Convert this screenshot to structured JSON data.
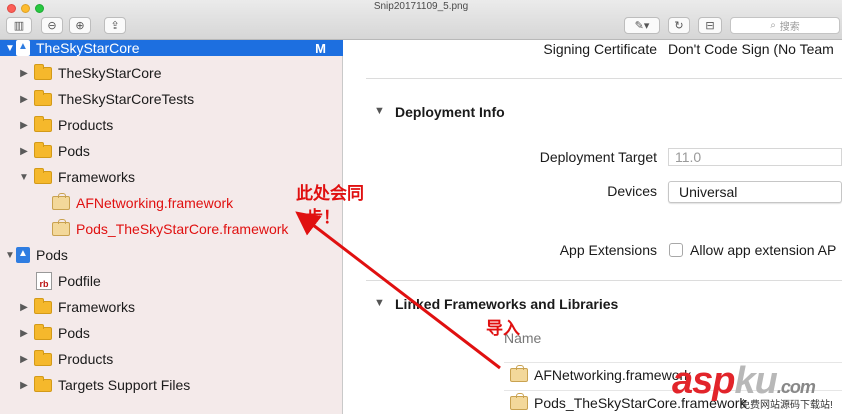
{
  "window": {
    "title": "Snip20171109_5.png",
    "search_placeholder": "搜索"
  },
  "sidebar": {
    "items": [
      {
        "label": "TheSkyStarCore",
        "badge": "M"
      },
      {
        "label": "TheSkyStarCore"
      },
      {
        "label": "TheSkyStarCoreTests"
      },
      {
        "label": "Products"
      },
      {
        "label": "Pods"
      },
      {
        "label": "Frameworks"
      },
      {
        "label": "AFNetworking.framework"
      },
      {
        "label": "Pods_TheSkyStarCore.framework"
      },
      {
        "label": "Pods"
      },
      {
        "label": "Podfile"
      },
      {
        "label": "Frameworks"
      },
      {
        "label": "Pods"
      },
      {
        "label": "Products"
      },
      {
        "label": "Targets Support Files"
      }
    ]
  },
  "main": {
    "signing_label": "Signing Certificate",
    "signing_value": "Don't Code Sign (No Team",
    "deployment_title": "Deployment Info",
    "deployment_target_label": "Deployment Target",
    "deployment_target_value": "11.0",
    "devices_label": "Devices",
    "devices_value": "Universal",
    "app_ext_label": "App Extensions",
    "app_ext_value": "Allow app extension AP",
    "linked_title": "Linked Frameworks and Libraries",
    "list_header": "Name",
    "linked_items": [
      "AFNetworking.framework",
      "Pods_TheSkyStarCore.framework"
    ]
  },
  "annotations": {
    "sync_line1": "此处会同",
    "sync_line2": "步！",
    "import": "导入"
  },
  "watermark": {
    "text_asp": "asp",
    "text_ku": "ku",
    "text_com": ".com",
    "subtitle": "免费网站源码下载站!"
  },
  "colors": {
    "selection": "#1d6fe0",
    "annotation": "#e01010",
    "sidebar_bg": "#f4eaea"
  }
}
